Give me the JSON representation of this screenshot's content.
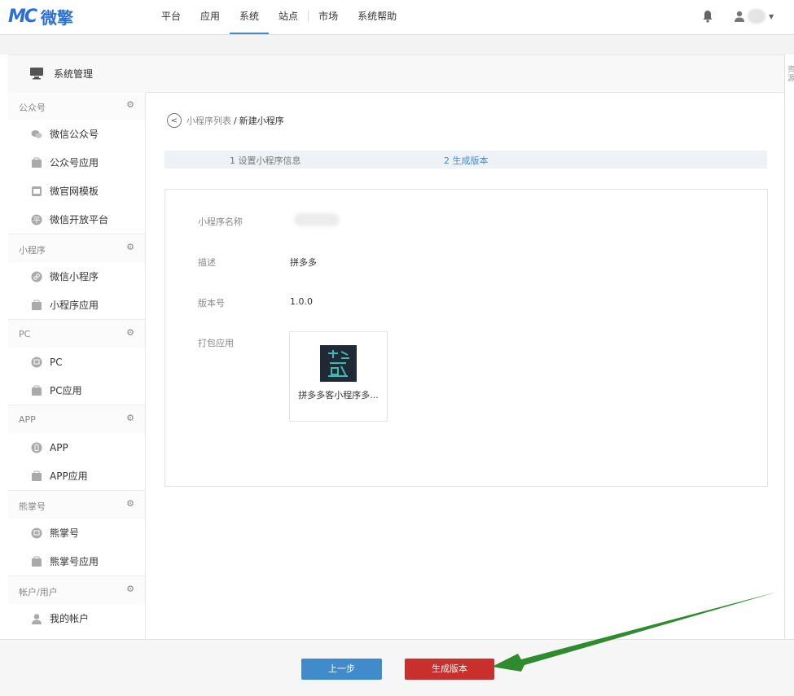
{
  "header": {
    "logo_mark": "MC",
    "logo_text": "微擎",
    "nav": [
      "平台",
      "应用",
      "系统",
      "站点",
      "市场",
      "系统帮助"
    ],
    "active_nav": "系统"
  },
  "panel": {
    "title": "系统管理"
  },
  "right_strip_text": "资源",
  "sidebar": {
    "sections": [
      {
        "title": "公众号",
        "items": [
          {
            "label": "微信公众号",
            "icon": "wechat-icon"
          },
          {
            "label": "公众号应用",
            "icon": "app-bag-icon"
          },
          {
            "label": "微官网模板",
            "icon": "template-icon"
          },
          {
            "label": "微信开放平台",
            "icon": "open-platform-icon"
          }
        ]
      },
      {
        "title": "小程序",
        "items": [
          {
            "label": "微信小程序",
            "icon": "miniprogram-icon"
          },
          {
            "label": "小程序应用",
            "icon": "app-bag-icon"
          }
        ]
      },
      {
        "title": "PC",
        "items": [
          {
            "label": "PC",
            "icon": "monitor-icon"
          },
          {
            "label": "PC应用",
            "icon": "app-bag-icon"
          }
        ]
      },
      {
        "title": "APP",
        "items": [
          {
            "label": "APP",
            "icon": "phone-icon"
          },
          {
            "label": "APP应用",
            "icon": "app-bag-icon"
          }
        ]
      },
      {
        "title": "熊掌号",
        "items": [
          {
            "label": "熊掌号",
            "icon": "monitor-icon"
          },
          {
            "label": "熊掌号应用",
            "icon": "app-bag-icon"
          }
        ]
      },
      {
        "title": "帐户/用户",
        "items": [
          {
            "label": "我的帐户",
            "icon": "user-icon"
          }
        ]
      }
    ]
  },
  "breadcrumb": {
    "link": "小程序列表",
    "separator": "/",
    "current": "新建小程序"
  },
  "steps": [
    "1 设置小程序信息",
    "2 生成版本"
  ],
  "form": {
    "name_label": "小程序名称",
    "desc_label": "描述",
    "desc_value": "拼多多",
    "version_label": "版本号",
    "version_value": "1.0.0",
    "package_label": "打包应用",
    "app_name": "拼多多客小程序多..."
  },
  "buttons": {
    "prev": "上一步",
    "generate": "生成版本"
  },
  "colors": {
    "primary": "#428bca",
    "danger": "#c9302c",
    "brand": "#2b6fd6",
    "arrow": "#2e8b2e"
  }
}
